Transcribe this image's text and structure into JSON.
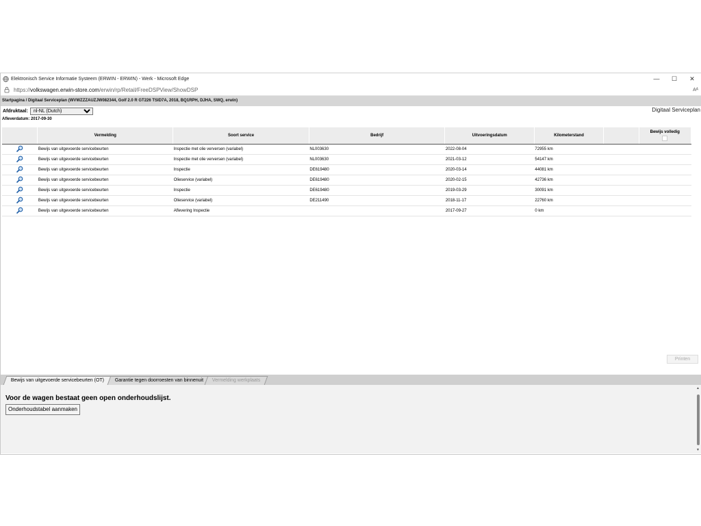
{
  "window": {
    "title": "Elektronisch Service Informatie Systeem (ERWIN - ERWIN) - Werk - Microsoft Edge",
    "minimize": "—",
    "maximize": "☐",
    "close": "✕"
  },
  "address": {
    "prefix": "https://",
    "host": "volkswagen.erwin-store.com",
    "path": "/erwin/rp/Retail/FreeDSPView/ShowDSP",
    "reader": "Aᴬ"
  },
  "breadcrumb": "Startpagina / Digitaal Serviceplan (WVWZZZAUZJW082344, Golf 2.0 R GT226 TSID7A, 2018, BQ1RPH, DJHA, SWQ, erwin)",
  "print_language": {
    "label": "Afdruktaal:",
    "value": "nl-NL (Dutch)"
  },
  "page_heading": "Digitaal Serviceplan",
  "delivery_date": "Afleverdatum: 2017-09-30",
  "table": {
    "headers": [
      "Vermelding",
      "Soort service",
      "Bedrijf",
      "Uitvoeringsdatum",
      "Kilometerstand",
      "",
      "Bewijs volledig"
    ],
    "rows": [
      {
        "vermelding": "Bewijs van uitgevoerde servicebeurten",
        "soort": "Inspectie met olie verversen (variabel)",
        "bedrijf": "NL003630",
        "datum": "2022-08-04",
        "km": "72955 km"
      },
      {
        "vermelding": "Bewijs van uitgevoerde servicebeurten",
        "soort": "Inspectie met olie verversen (variabel)",
        "bedrijf": "NL003630",
        "datum": "2021-03-12",
        "km": "54147 km"
      },
      {
        "vermelding": "Bewijs van uitgevoerde servicebeurten",
        "soort": "Inspectie",
        "bedrijf": "DE619480",
        "datum": "2020-03-14",
        "km": "44081 km"
      },
      {
        "vermelding": "Bewijs van uitgevoerde servicebeurten",
        "soort": "Olieservice (variabel)",
        "bedrijf": "DE619480",
        "datum": "2020-02-15",
        "km": "42736 km"
      },
      {
        "vermelding": "Bewijs van uitgevoerde servicebeurten",
        "soort": "Inspectie",
        "bedrijf": "DE619480",
        "datum": "2019-03-29",
        "km": "30091 km"
      },
      {
        "vermelding": "Bewijs van uitgevoerde servicebeurten",
        "soort": "Olieservice (variabel)",
        "bedrijf": "DE211490",
        "datum": "2018-11-17",
        "km": "22760 km"
      },
      {
        "vermelding": "Bewijs van uitgevoerde servicebeurten",
        "soort": "Aflevering Inspectie",
        "bedrijf": "",
        "datum": "2017-09-27",
        "km": "0 km"
      }
    ]
  },
  "print_button": "Printen",
  "tabs": [
    {
      "label": "Bewijs van uitgevoerde servicebeurten (OT)",
      "state": "active"
    },
    {
      "label": "Garantie tegen doorroesten van binnenuit",
      "state": "normal"
    },
    {
      "label": "Vermelding werkplaats",
      "state": "disabled"
    }
  ],
  "panel": {
    "message": "Voor de wagen bestaat geen open onderhoudslijst.",
    "create_button": "Onderhoudstabel aanmaken"
  },
  "icons": {
    "globe": "globe-icon",
    "lock": "lock-icon",
    "detail": "magnifier-icon"
  },
  "colors": {
    "breadcrumb_bg": "#d6d6d6",
    "header_bg": "#ececec",
    "icon_blue": "#1f5fa8"
  }
}
